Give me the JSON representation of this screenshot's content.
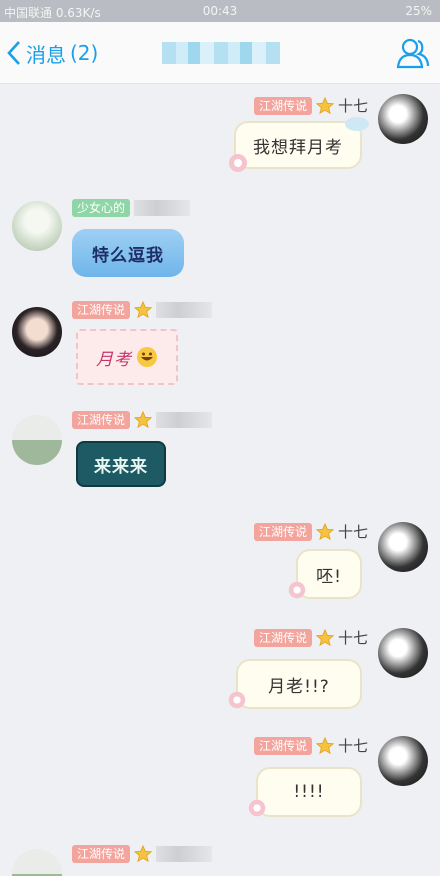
{
  "status_bar": {
    "left": "中国联通 0.63K/s",
    "time": "00:43",
    "right": "25%"
  },
  "nav": {
    "back_label": "消息",
    "unread_count": "(2)"
  },
  "messages": [
    {
      "side": "right",
      "tag": "江湖传说",
      "nickname": "十七",
      "text": "我想拜月考",
      "bubble": "cream"
    },
    {
      "side": "left",
      "tag": "少女心的",
      "nickname": "",
      "text": "特么逗我",
      "bubble": "blue"
    },
    {
      "side": "left",
      "tag": "江湖传说",
      "nickname": "",
      "text": "月考",
      "bubble": "pink"
    },
    {
      "side": "left",
      "tag": "江湖传说",
      "nickname": "",
      "text": "来来来",
      "bubble": "dark"
    },
    {
      "side": "right",
      "tag": "江湖传说",
      "nickname": "十七",
      "text": "呸!",
      "bubble": "cream"
    },
    {
      "side": "right",
      "tag": "江湖传说",
      "nickname": "十七",
      "text": "月老!!?",
      "bubble": "cream"
    },
    {
      "side": "right",
      "tag": "江湖传说",
      "nickname": "十七",
      "text": "!!!!",
      "bubble": "cream"
    },
    {
      "side": "left",
      "tag": "江湖传说",
      "nickname": "",
      "text": "",
      "bubble": "none"
    }
  ],
  "icons": [
    "back-chevron-icon",
    "contact-icon",
    "star-icon",
    "laugh-emoji-icon"
  ],
  "colors": {
    "accent": "#1aa0e8",
    "tag": "#f3a49c",
    "background": "#eef0f3"
  }
}
